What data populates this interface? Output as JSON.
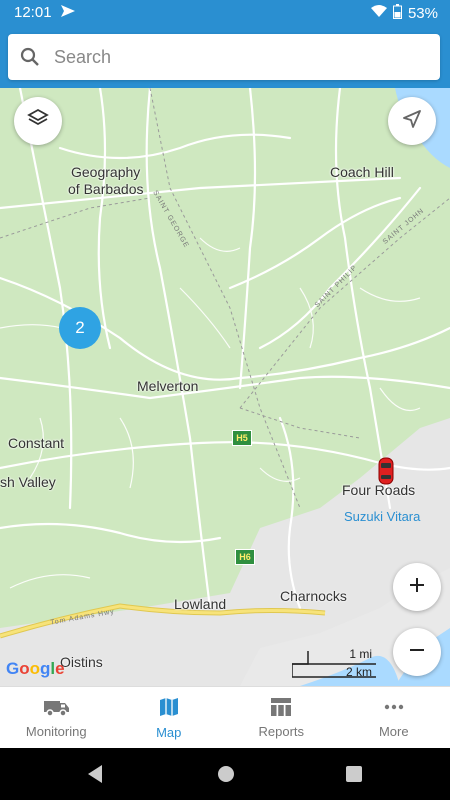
{
  "status_bar": {
    "time": "12:01",
    "battery": "53%"
  },
  "search": {
    "placeholder": "Search"
  },
  "map": {
    "labels": {
      "geography_line1": "Geography",
      "geography_line2": "of Barbados",
      "coach_hill": "Coach Hill",
      "melverton": "Melverton",
      "constant": "Constant",
      "sh_valley": "sh Valley",
      "four_roads": "Four Roads",
      "lowland": "Lowland",
      "charnocks": "Charnocks",
      "oistins": "Oistins",
      "parish_st_george": "SAINT GEORGE",
      "parish_st_philip": "SAINT PHILIP",
      "parish_st_john": "SAINT JOHN",
      "highway_label": "Tom Adams Hwy"
    },
    "highway_shields": {
      "h5": "H5",
      "h6": "H6"
    },
    "cluster_count": "2",
    "vehicle_name": "Suzuki Vitara",
    "scale": {
      "miles": "1 mi",
      "km": "2 km"
    },
    "google_logo": "Google",
    "colors": {
      "land": "#cfe8c0",
      "water": "#aadaff",
      "urban": "#e8e8e8",
      "road": "#ffffff",
      "highway": "#f7e37a",
      "accent": "#2a8fd1"
    }
  },
  "bottom_nav": {
    "items": [
      {
        "label": "Monitoring",
        "icon": "van-icon"
      },
      {
        "label": "Map",
        "icon": "map-icon"
      },
      {
        "label": "Reports",
        "icon": "table-icon"
      },
      {
        "label": "More",
        "icon": "more-dots-icon"
      }
    ],
    "active": "Map"
  }
}
